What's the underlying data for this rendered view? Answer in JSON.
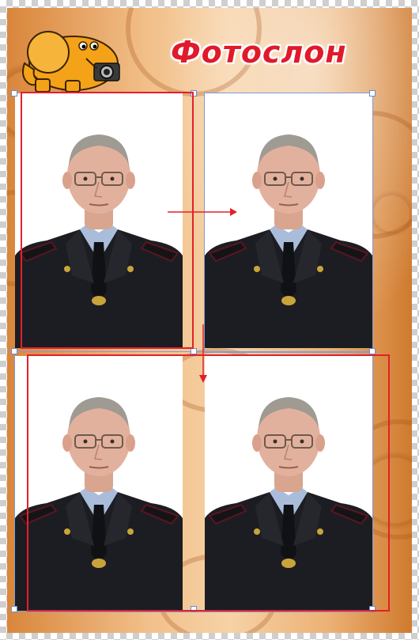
{
  "brand": {
    "title": "Фотослон",
    "title_color": "#e0192b",
    "mascot_icon": "elephant-with-camera-icon"
  },
  "layout_grid": {
    "photo_count": 4,
    "photo_subject": "passport-portrait"
  },
  "colors": {
    "background": "#e9a865",
    "selection_border": "#7f9bd8",
    "annotation_red": "#e4202a"
  },
  "annotations": {
    "move_right_arrow": "arrow-right-icon",
    "move_down_arrow": "arrow-down-icon"
  }
}
